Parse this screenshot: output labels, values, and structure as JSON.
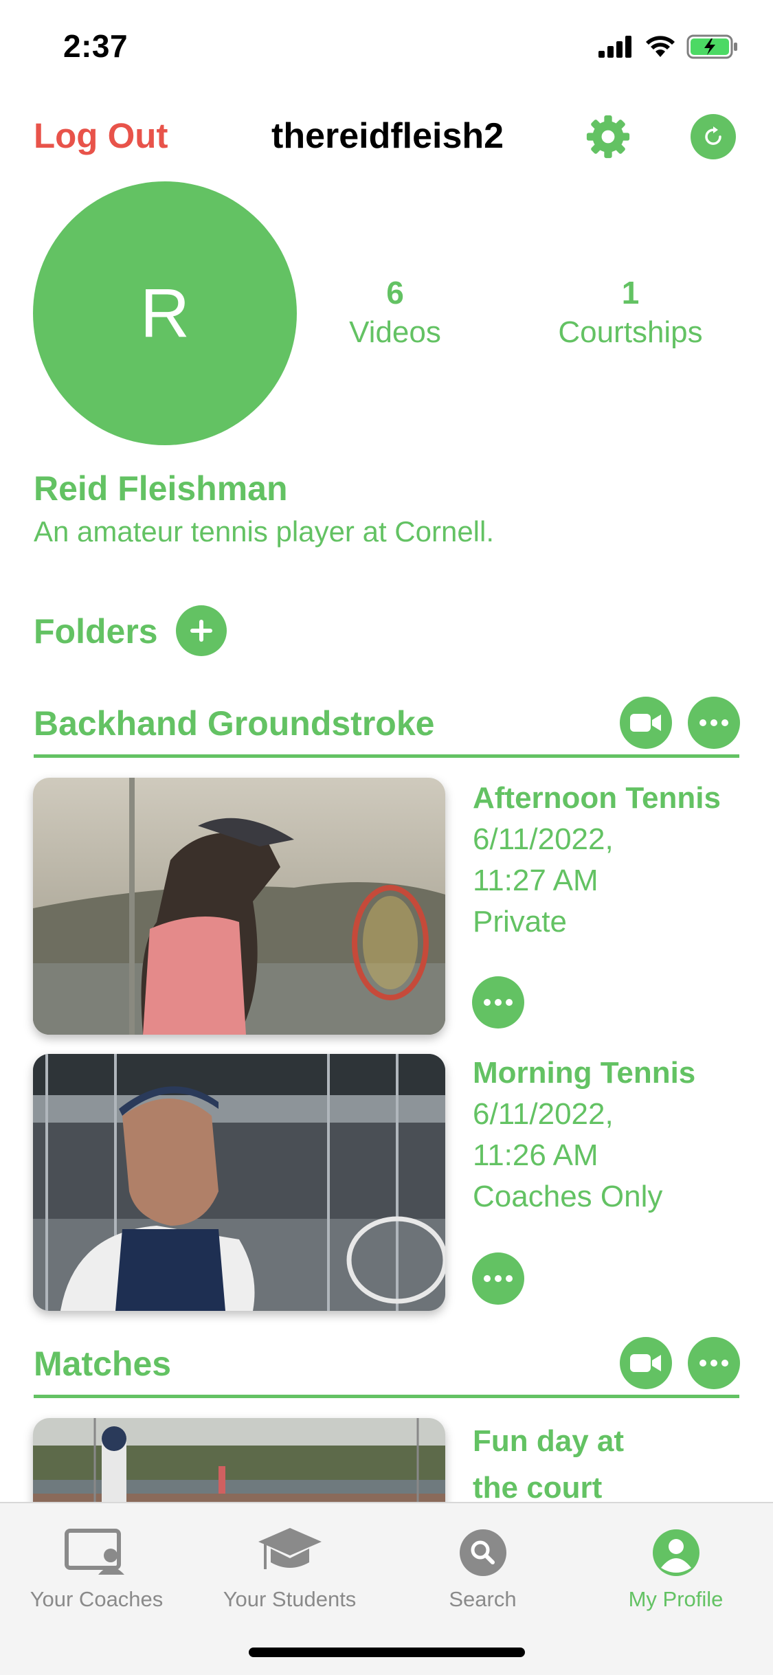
{
  "status": {
    "time": "2:37"
  },
  "header": {
    "logout_label": "Log Out",
    "username": "thereidfleish2"
  },
  "profile": {
    "avatar_initial": "R",
    "videos_count": "6",
    "videos_label": "Videos",
    "courtships_count": "1",
    "courtships_label": "Courtships",
    "name": "Reid Fleishman",
    "bio": "An amateur tennis player at Cornell."
  },
  "folders": {
    "label": "Folders",
    "sections": [
      {
        "title": "Backhand Groundstroke",
        "videos": [
          {
            "title": "Afternoon Tennis",
            "date": "6/11/2022,",
            "time": "11:27 AM",
            "visibility": "Private"
          },
          {
            "title": "Morning Tennis",
            "date": "6/11/2022,",
            "time": "11:26 AM",
            "visibility": "Coaches Only"
          }
        ]
      },
      {
        "title": "Matches",
        "videos": [
          {
            "title_line1": "Fun day at",
            "title_line2": "the court"
          }
        ]
      }
    ]
  },
  "tabbar": {
    "tabs": [
      {
        "label": "Your Coaches",
        "icon": "coaches-icon"
      },
      {
        "label": "Your Students",
        "icon": "graduation-cap-icon"
      },
      {
        "label": "Search",
        "icon": "search-icon"
      },
      {
        "label": "My Profile",
        "icon": "person-icon"
      }
    ],
    "active": "My Profile"
  },
  "colors": {
    "accent": "#63c263",
    "logout": "#e8534a",
    "tab_inactive": "#8a8a8a"
  }
}
